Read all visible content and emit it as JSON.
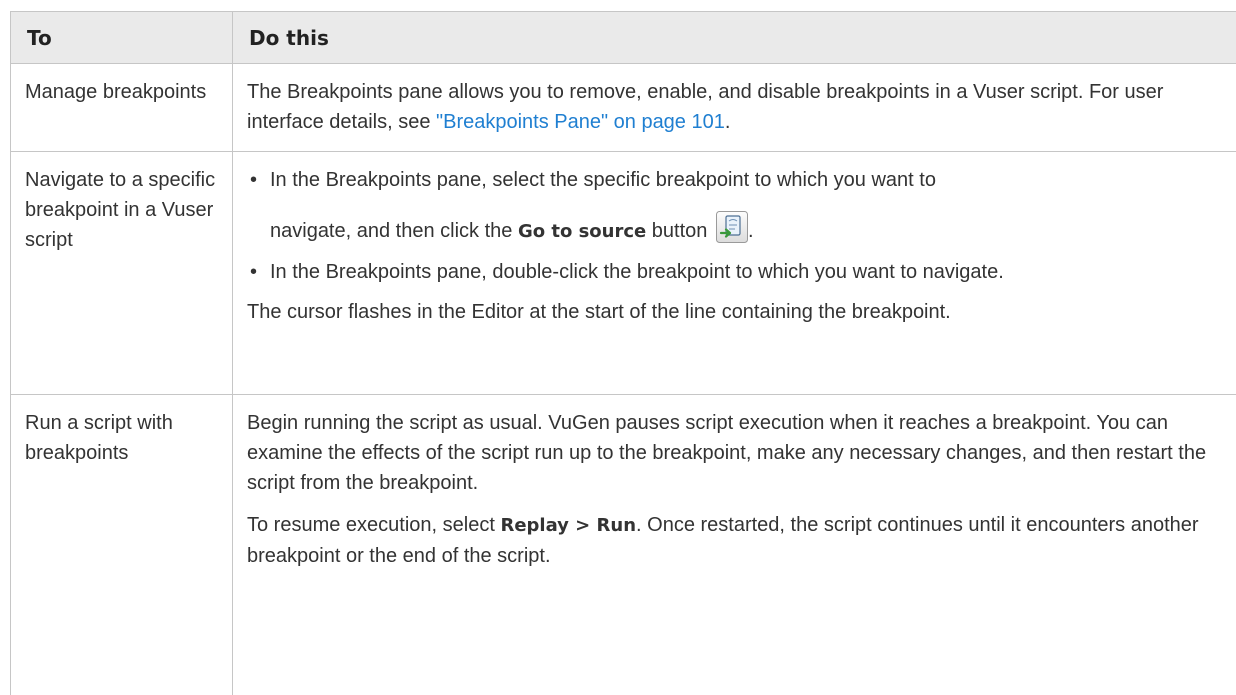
{
  "table": {
    "headers": {
      "to": "To",
      "do": "Do this"
    },
    "rows": {
      "manage": {
        "to": "Manage breakpoints",
        "text": "The Breakpoints pane allows you to remove, enable, and disable breakpoints in a Vuser script. For user interface details, see ",
        "link": "\"Breakpoints Pane\" on page 101",
        "after": "."
      },
      "navigate": {
        "to": "Navigate to a specific breakpoint in a Vuser script",
        "bullet1_a": "In the Breakpoints pane, select the specific breakpoint to which you want to",
        "bullet1_b": "navigate, and then click the ",
        "bullet1_bold": "Go to source",
        "bullet1_c": " button ",
        "bullet1_end": ".",
        "bullet2": "In the Breakpoints pane, double-click the breakpoint to which you want to navigate.",
        "note": "The cursor flashes in the Editor at the start of the line containing the breakpoint.",
        "icon": "go-to-source-icon"
      },
      "run": {
        "to": "Run a script with breakpoints",
        "para1": "Begin running the script as usual. VuGen pauses script execution when it reaches a breakpoint. You can examine the effects of the script run up to the breakpoint, make any necessary changes, and then restart the script from the breakpoint.",
        "para2_a": "To resume execution, select ",
        "para2_bold": "Replay > Run",
        "para2_b": ". Once restarted, the script continues until it encounters another breakpoint or the end of the script."
      }
    }
  },
  "colors": {
    "link": "#1f7fd1",
    "header_bg": "#eaeaea",
    "border": "#c6c6c6"
  }
}
